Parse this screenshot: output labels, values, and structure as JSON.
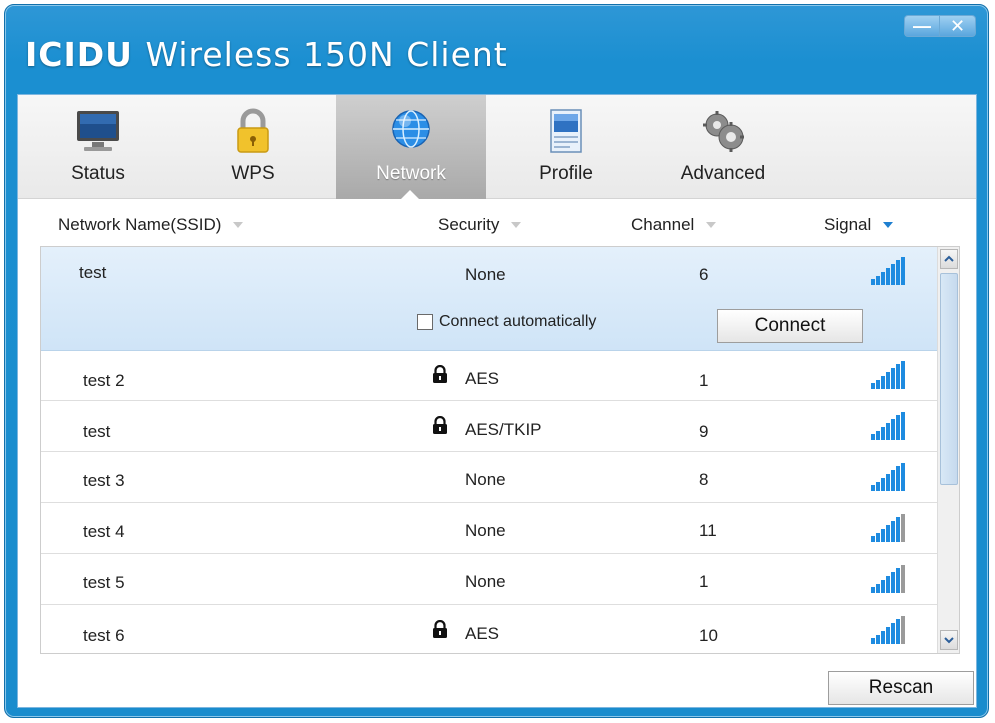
{
  "window": {
    "brand": "ICIDU",
    "title": "Wireless 150N Client"
  },
  "tabs": [
    {
      "label": "Status",
      "icon": "monitor-icon"
    },
    {
      "label": "WPS",
      "icon": "padlock-icon"
    },
    {
      "label": "Network",
      "icon": "globe-icon",
      "active": true
    },
    {
      "label": "Profile",
      "icon": "profile-document-icon"
    },
    {
      "label": "Advanced",
      "icon": "gears-icon"
    }
  ],
  "columns": [
    {
      "label": "Network Name(SSID)"
    },
    {
      "label": "Security"
    },
    {
      "label": "Channel"
    },
    {
      "label": "Signal",
      "sorted": true
    }
  ],
  "selected_network": {
    "ssid": "test",
    "security": "None",
    "channel": "6",
    "connect_automatically_label": "Connect automatically",
    "connect_automatically_checked": false,
    "connect_label": "Connect"
  },
  "networks": [
    {
      "ssid": "test 2",
      "security": "AES",
      "locked": true,
      "channel": "1"
    },
    {
      "ssid": "test",
      "security": "AES/TKIP",
      "locked": true,
      "channel": "9"
    },
    {
      "ssid": "test 3",
      "security": "None",
      "locked": false,
      "channel": "8"
    },
    {
      "ssid": "test 4",
      "security": "None",
      "locked": false,
      "channel": "11"
    },
    {
      "ssid": "test 5",
      "security": "None",
      "locked": false,
      "channel": "1"
    },
    {
      "ssid": "test 6",
      "security": "AES",
      "locked": true,
      "channel": "10"
    }
  ],
  "rescan_label": "Rescan",
  "colors": {
    "frame": "#1a8ccd",
    "selected_row": "#d8e9f8",
    "signal": "#1e8be0"
  }
}
